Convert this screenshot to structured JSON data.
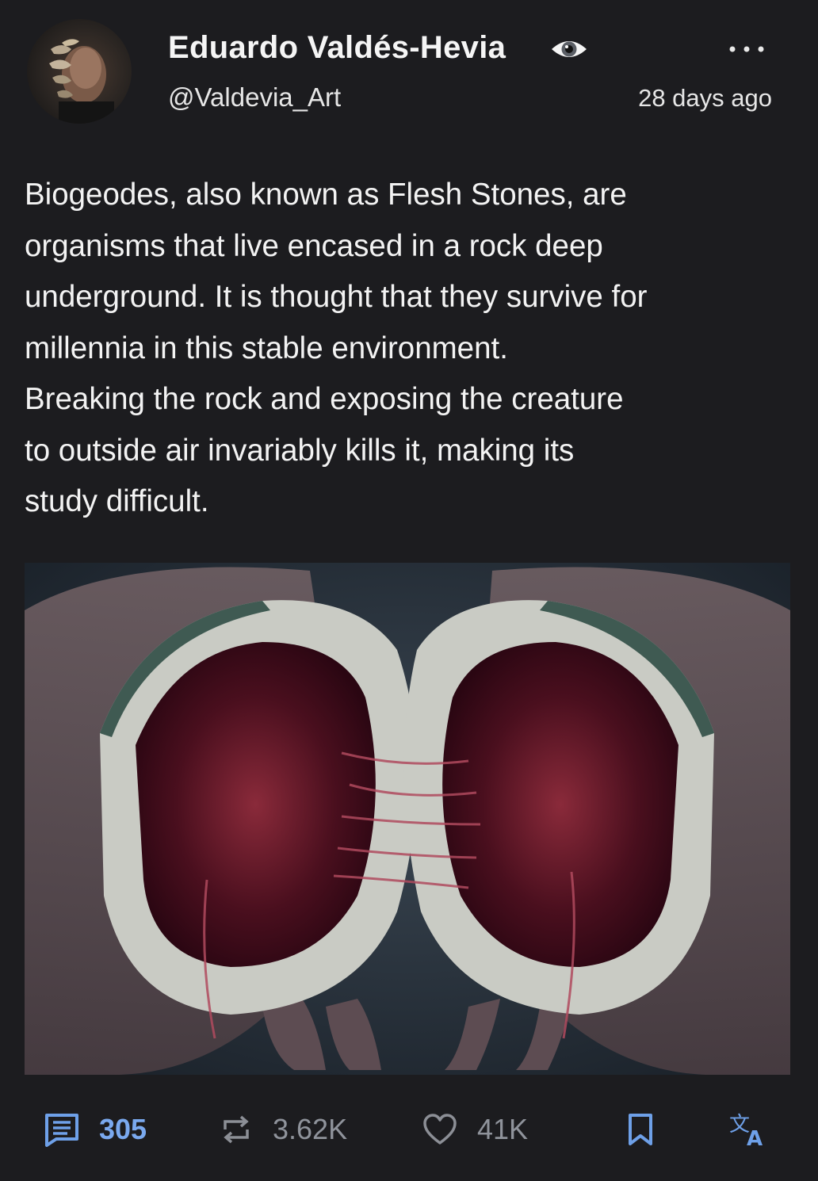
{
  "author": {
    "display_name": "Eduardo Valdés-Hevia",
    "handle": "@Valdevia_Art",
    "badge_icon": "eye-icon",
    "avatar_alt": "avatar"
  },
  "post": {
    "timestamp": "28 days ago",
    "text_lines": [
      "Biogeodes, also known as Flesh Stones, are",
      "organisms that live encased in a rock deep",
      "underground. It is thought that they survive for",
      "millennia in this stable environment.",
      "Breaking the rock and exposing the creature",
      "to outside air invariably kills it, making its",
      "study difficult."
    ],
    "media_alt": "Two hands holding a split-open rock with red fleshy tissue inside"
  },
  "actions": {
    "replies": "305",
    "reposts": "3.62K",
    "likes": "41K",
    "icons": {
      "reply": "comment-icon",
      "repost": "repost-icon",
      "like": "heart-icon",
      "bookmark": "bookmark-icon",
      "translate": "translate-icon",
      "more": "more-icon"
    }
  },
  "colors": {
    "background": "#1c1c1f",
    "text": "#f3f3f3",
    "accent": "#6ea0e8",
    "muted": "#8c8f96"
  }
}
